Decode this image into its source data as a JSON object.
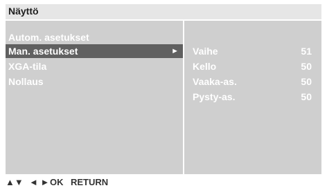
{
  "title": "Näyttö",
  "menu": {
    "items": [
      {
        "label": "Autom. asetukset",
        "selected": false
      },
      {
        "label": "Man. asetukset",
        "selected": true,
        "arrow": "►"
      },
      {
        "label": "XGA-tila",
        "selected": false
      },
      {
        "label": "Nollaus",
        "selected": false
      }
    ]
  },
  "settings": [
    {
      "name": "Vaihe",
      "value": "51"
    },
    {
      "name": "Kello",
      "value": "50"
    },
    {
      "name": "Vaaka-as.",
      "value": "50"
    },
    {
      "name": "Pysty-as.",
      "value": "50"
    }
  ],
  "help": {
    "updown": "▲▼",
    "leftright": "◄ ►",
    "ok": "OK",
    "return": "RETURN"
  },
  "colors": {
    "panel": "#cfcfcf",
    "title_bar": "#e6e6e6",
    "selected": "#606060",
    "text": "#ffffff"
  }
}
